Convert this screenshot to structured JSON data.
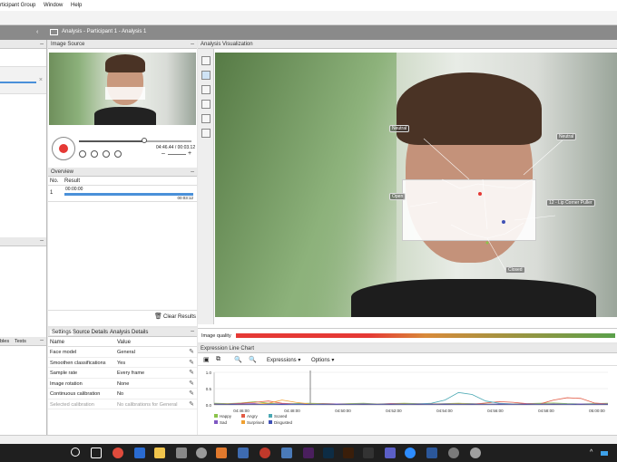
{
  "menu": {
    "item1": "rticipant Group",
    "item2": "Window",
    "item3": "Help"
  },
  "breadcrumb": "Analysis - Participant 1 - Analysis 1",
  "image_source": {
    "title": "Image Source",
    "time": "04:46.44 / 00:03.12"
  },
  "overview": {
    "title": "Overview",
    "col_no": "No.",
    "col_result": "Result",
    "row_no": "1",
    "row_start": "00:00:00",
    "row_end": "00:03:12",
    "clear_label": "Clear Results"
  },
  "settings": {
    "tabs": [
      "Settings",
      "Source Details",
      "Analysis Details"
    ],
    "col_name": "Name",
    "col_value": "Value",
    "rows": [
      {
        "name": "Face model",
        "value": "General"
      },
      {
        "name": "Smoothen classifications",
        "value": "Yes"
      },
      {
        "name": "Sample rate",
        "value": "Every frame"
      },
      {
        "name": "Image rotation",
        "value": "None"
      },
      {
        "name": "Continuous calibration",
        "value": "No"
      },
      {
        "name": "Selected calibration",
        "value": "No calibrations for General"
      }
    ]
  },
  "left_tabs": {
    "t1": "bles",
    "t2": "Tests"
  },
  "visualization": {
    "title": "Analysis Visualization",
    "labels": {
      "neutral_left": "Neutral",
      "neutral_right": "Neutral",
      "open": "Open",
      "lip": "12 - Lip Corner Puller",
      "closed": "Closed"
    },
    "quality_label": "Image quality"
  },
  "chart_panel": {
    "title": "Expression Line Chart",
    "expressions_btn": "Expressions",
    "options_btn": "Options"
  },
  "chart_data": {
    "type": "line",
    "ylim": [
      0,
      1
    ],
    "yticks": [
      "1.0",
      "0.5",
      "0.0"
    ],
    "xticks": [
      "04:46:00",
      "04:48:00",
      "04:50:00",
      "04:52:00",
      "04:54:00",
      "04:56:00",
      "04:58:00",
      "05:00:00"
    ],
    "x": [
      0,
      0.5,
      1,
      1.5,
      2,
      2.5,
      3,
      3.5,
      4,
      4.5,
      5,
      5.5,
      6,
      6.5,
      7,
      7.5,
      8,
      8.5,
      9,
      9.5,
      10,
      10.5,
      11,
      11.5,
      12,
      12.5,
      13,
      13.5,
      14,
      14.5
    ],
    "series": [
      {
        "name": "Happy",
        "color": "#8bc34a",
        "values": [
          0.05,
          0.04,
          0.06,
          0.1,
          0.05,
          0.03,
          0.04,
          0.05,
          0.04,
          0.03,
          0.04,
          0.05,
          0.03,
          0.04,
          0.05,
          0.04,
          0.03,
          0.04,
          0.05,
          0.04,
          0.03,
          0.02,
          0.03,
          0.04,
          0.05,
          0.06,
          0.04,
          0.03,
          0.04,
          0.05
        ]
      },
      {
        "name": "Angry",
        "color": "#e25b45",
        "values": [
          0.02,
          0.03,
          0.05,
          0.08,
          0.12,
          0.05,
          0.03,
          0.02,
          0.04,
          0.03,
          0.02,
          0.03,
          0.02,
          0.04,
          0.03,
          0.02,
          0.03,
          0.02,
          0.03,
          0.02,
          0.06,
          0.1,
          0.08,
          0.04,
          0.03,
          0.15,
          0.22,
          0.2,
          0.06,
          0.03
        ]
      },
      {
        "name": "Scared",
        "color": "#4aa8b3",
        "values": [
          0.02,
          0.02,
          0.03,
          0.02,
          0.03,
          0.02,
          0.03,
          0.04,
          0.03,
          0.02,
          0.02,
          0.03,
          0.02,
          0.03,
          0.02,
          0.03,
          0.05,
          0.15,
          0.38,
          0.32,
          0.12,
          0.05,
          0.03,
          0.02,
          0.03,
          0.02,
          0.03,
          0.02,
          0.03,
          0.02
        ]
      },
      {
        "name": "Sad",
        "color": "#7e57c2",
        "values": [
          0.03,
          0.02,
          0.03,
          0.04,
          0.02,
          0.03,
          0.02,
          0.03,
          0.02,
          0.03,
          0.02,
          0.03,
          0.02,
          0.03,
          0.02,
          0.03,
          0.02,
          0.03,
          0.02,
          0.03,
          0.02,
          0.03,
          0.02,
          0.03,
          0.02,
          0.03,
          0.02,
          0.03,
          0.02,
          0.03
        ]
      },
      {
        "name": "Surprised",
        "color": "#f0a030",
        "values": [
          0.01,
          0.02,
          0.01,
          0.02,
          0.05,
          0.15,
          0.08,
          0.03,
          0.02,
          0.01,
          0.02,
          0.01,
          0.02,
          0.01,
          0.02,
          0.01,
          0.02,
          0.01,
          0.02,
          0.01,
          0.02,
          0.01,
          0.02,
          0.01,
          0.02,
          0.01,
          0.02,
          0.01,
          0.02,
          0.01
        ]
      },
      {
        "name": "Disgusted",
        "color": "#3f51b5",
        "values": [
          0.02,
          0.01,
          0.02,
          0.01,
          0.02,
          0.01,
          0.02,
          0.01,
          0.02,
          0.01,
          0.02,
          0.01,
          0.02,
          0.01,
          0.02,
          0.01,
          0.02,
          0.01,
          0.02,
          0.01,
          0.02,
          0.01,
          0.02,
          0.01,
          0.02,
          0.01,
          0.02,
          0.01,
          0.02,
          0.01
        ]
      }
    ]
  },
  "colors": {
    "record": "#e53935",
    "accent": "#4a90d9"
  }
}
